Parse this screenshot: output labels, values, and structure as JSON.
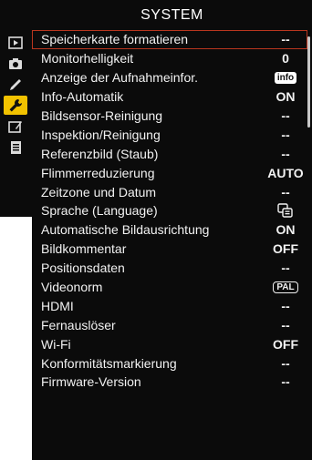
{
  "header": {
    "title": "SYSTEM"
  },
  "sidebar": {
    "items": [
      {
        "icon": "playback-icon",
        "active": false
      },
      {
        "icon": "camera-icon",
        "active": false
      },
      {
        "icon": "pencil-icon",
        "active": false
      },
      {
        "icon": "wrench-icon",
        "active": true
      },
      {
        "icon": "retouch-icon",
        "active": false
      },
      {
        "icon": "my-menu-icon",
        "active": false
      }
    ]
  },
  "menu": {
    "items": [
      {
        "label": "Speicherkarte formatieren",
        "value": "--"
      },
      {
        "label": "Monitorhelligkeit",
        "value": "0"
      },
      {
        "label": "Anzeige der Aufnahmeinfor.",
        "value": "info",
        "value_style": "badge-info"
      },
      {
        "label": "Info-Automatik",
        "value": "ON"
      },
      {
        "label": "Bildsensor-Reinigung",
        "value": "--"
      },
      {
        "label": "Inspektion/Reinigung",
        "value": "--"
      },
      {
        "label": "Referenzbild (Staub)",
        "value": "--"
      },
      {
        "label": "Flimmerreduzierung",
        "value": "AUTO"
      },
      {
        "label": "Zeitzone und Datum",
        "value": "--"
      },
      {
        "label": "Sprache (Language)",
        "value": "",
        "value_icon": "language-icon"
      },
      {
        "label": "Automatische Bildausrichtung",
        "value": "ON"
      },
      {
        "label": "Bildkommentar",
        "value": "OFF"
      },
      {
        "label": "Positionsdaten",
        "value": "--"
      },
      {
        "label": "Videonorm",
        "value": "PAL",
        "value_style": "badge-pal"
      },
      {
        "label": "HDMI",
        "value": "--"
      },
      {
        "label": "Fernauslöser",
        "value": "--"
      },
      {
        "label": "Wi-Fi",
        "value": "OFF"
      },
      {
        "label": "Konformitätsmarkierung",
        "value": "--"
      },
      {
        "label": "Firmware-Version",
        "value": "--"
      }
    ]
  },
  "colors": {
    "background": "#0b0b0b",
    "active_tab": "#f2c200",
    "selection_border": "#b9361f",
    "text": "#f2f2f2"
  }
}
